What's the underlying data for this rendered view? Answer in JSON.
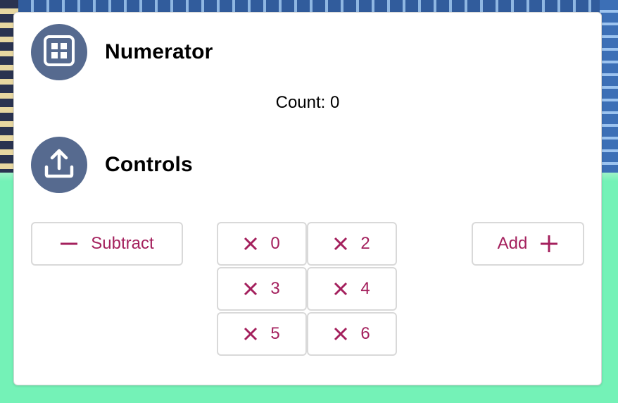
{
  "numerator": {
    "title": "Numerator",
    "icon": "grid-icon",
    "count_label": "Count:",
    "count_value": "0"
  },
  "controls": {
    "title": "Controls",
    "icon": "upload-icon"
  },
  "buttons": {
    "subtract_label": "Subtract",
    "add_label": "Add",
    "multipliers": [
      {
        "value": "0"
      },
      {
        "value": "2"
      },
      {
        "value": "3"
      },
      {
        "value": "4"
      },
      {
        "value": "5"
      },
      {
        "value": "6"
      }
    ]
  },
  "colors": {
    "accent": "#a4205d",
    "avatar_bg": "#566a8f",
    "background": "#74f2b7"
  }
}
